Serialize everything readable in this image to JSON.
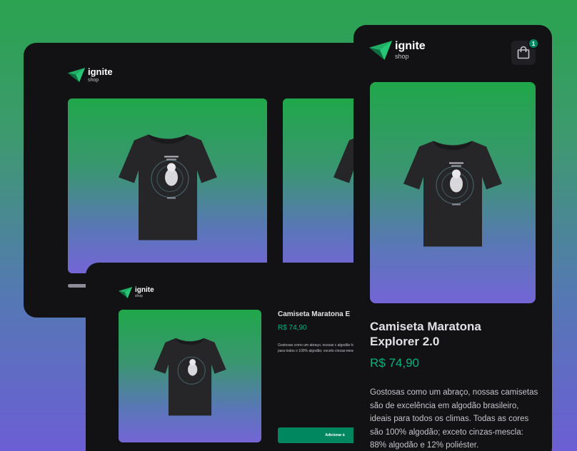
{
  "brand": {
    "name": "ignite",
    "sub": "shop",
    "accent": "#00875f",
    "price_color": "#00b37e"
  },
  "desktop": {
    "products": [
      {
        "image": "black-astronaut-tshirt"
      },
      {
        "image": "black-astronaut-tshirt"
      }
    ]
  },
  "product_page": {
    "title": "Camiseta Maratona E",
    "price": "R$ 74,90",
    "description": "Gostosas como um abraço, nossas c algodão brasileiro, ideais para todos o 100% algodão; exceto cinzas-mescla:",
    "button_label": "Adicionar à"
  },
  "mobile": {
    "cart_count": "1",
    "cart_icon": "shopping-bag-icon",
    "title": "Camiseta Maratona Explorer 2.0",
    "price": "R$ 74,90",
    "description": "Gostosas como um abraço, nossas camisetas são de excelência em algodão brasileiro, ideais para todos os climas. Todas as cores são 100% algodão; exceto cinzas-mescla: 88% algodão e 12% poliéster."
  }
}
